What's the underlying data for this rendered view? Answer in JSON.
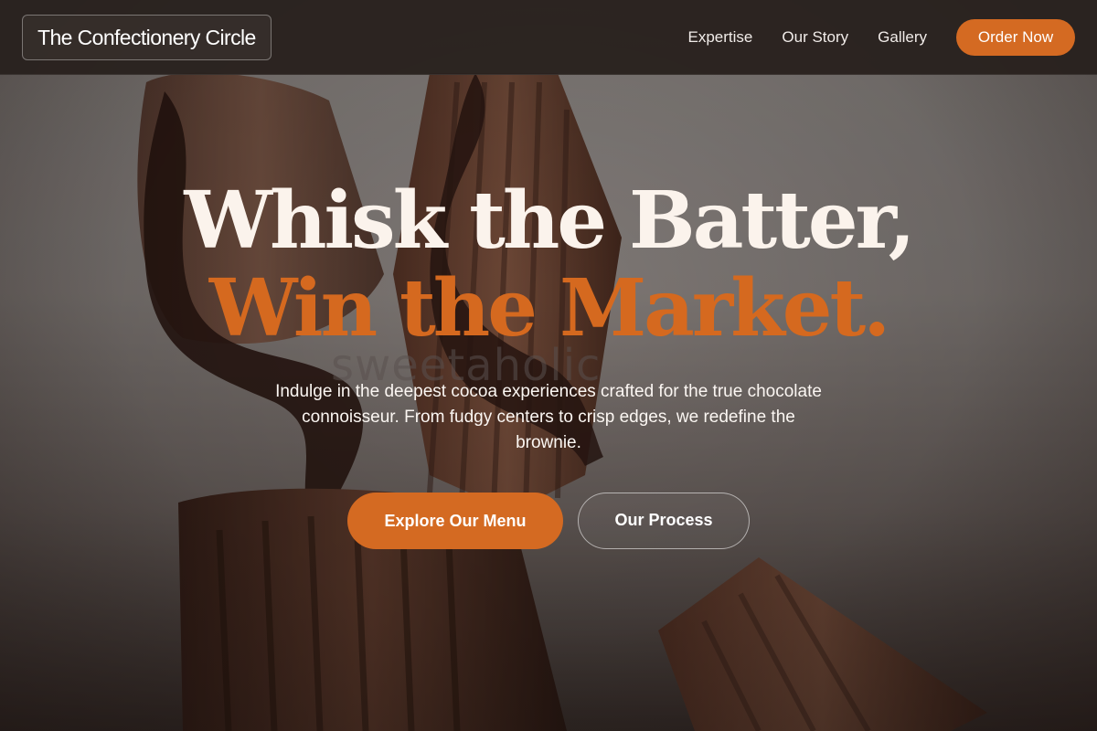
{
  "header": {
    "brand": "The Confectionery Circle",
    "nav": [
      {
        "label": "Expertise"
      },
      {
        "label": "Our Story"
      },
      {
        "label": "Gallery"
      }
    ],
    "cta_label": "Order Now"
  },
  "hero": {
    "headline_line1": "Whisk the Batter,",
    "headline_line2": "Win the Market.",
    "subtext": "Indulge in the deepest cocoa experiences crafted for the true chocolate connoisseur. From fudgy centers to crisp edges, we redefine the brownie.",
    "primary_cta": "Explore Our Menu",
    "secondary_cta": "Our Process",
    "background_watermark": "sweetaholic"
  },
  "colors": {
    "accent": "#d46a22",
    "header_bg": "#2d2522",
    "headline_light": "#fbf3ec"
  }
}
